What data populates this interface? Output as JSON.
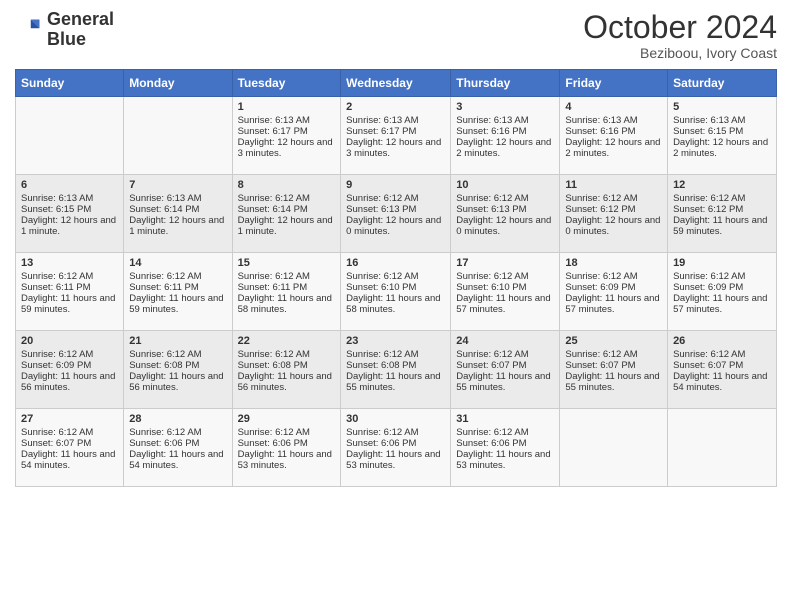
{
  "logo": {
    "line1": "General",
    "line2": "Blue"
  },
  "header": {
    "month": "October 2024",
    "location": "Beziboou, Ivory Coast"
  },
  "days": [
    "Sunday",
    "Monday",
    "Tuesday",
    "Wednesday",
    "Thursday",
    "Friday",
    "Saturday"
  ],
  "weeks": [
    [
      {
        "num": "",
        "sunrise": "",
        "sunset": "",
        "daylight": ""
      },
      {
        "num": "",
        "sunrise": "",
        "sunset": "",
        "daylight": ""
      },
      {
        "num": "1",
        "sunrise": "Sunrise: 6:13 AM",
        "sunset": "Sunset: 6:17 PM",
        "daylight": "Daylight: 12 hours and 3 minutes."
      },
      {
        "num": "2",
        "sunrise": "Sunrise: 6:13 AM",
        "sunset": "Sunset: 6:17 PM",
        "daylight": "Daylight: 12 hours and 3 minutes."
      },
      {
        "num": "3",
        "sunrise": "Sunrise: 6:13 AM",
        "sunset": "Sunset: 6:16 PM",
        "daylight": "Daylight: 12 hours and 2 minutes."
      },
      {
        "num": "4",
        "sunrise": "Sunrise: 6:13 AM",
        "sunset": "Sunset: 6:16 PM",
        "daylight": "Daylight: 12 hours and 2 minutes."
      },
      {
        "num": "5",
        "sunrise": "Sunrise: 6:13 AM",
        "sunset": "Sunset: 6:15 PM",
        "daylight": "Daylight: 12 hours and 2 minutes."
      }
    ],
    [
      {
        "num": "6",
        "sunrise": "Sunrise: 6:13 AM",
        "sunset": "Sunset: 6:15 PM",
        "daylight": "Daylight: 12 hours and 1 minute."
      },
      {
        "num": "7",
        "sunrise": "Sunrise: 6:13 AM",
        "sunset": "Sunset: 6:14 PM",
        "daylight": "Daylight: 12 hours and 1 minute."
      },
      {
        "num": "8",
        "sunrise": "Sunrise: 6:12 AM",
        "sunset": "Sunset: 6:14 PM",
        "daylight": "Daylight: 12 hours and 1 minute."
      },
      {
        "num": "9",
        "sunrise": "Sunrise: 6:12 AM",
        "sunset": "Sunset: 6:13 PM",
        "daylight": "Daylight: 12 hours and 0 minutes."
      },
      {
        "num": "10",
        "sunrise": "Sunrise: 6:12 AM",
        "sunset": "Sunset: 6:13 PM",
        "daylight": "Daylight: 12 hours and 0 minutes."
      },
      {
        "num": "11",
        "sunrise": "Sunrise: 6:12 AM",
        "sunset": "Sunset: 6:12 PM",
        "daylight": "Daylight: 12 hours and 0 minutes."
      },
      {
        "num": "12",
        "sunrise": "Sunrise: 6:12 AM",
        "sunset": "Sunset: 6:12 PM",
        "daylight": "Daylight: 11 hours and 59 minutes."
      }
    ],
    [
      {
        "num": "13",
        "sunrise": "Sunrise: 6:12 AM",
        "sunset": "Sunset: 6:11 PM",
        "daylight": "Daylight: 11 hours and 59 minutes."
      },
      {
        "num": "14",
        "sunrise": "Sunrise: 6:12 AM",
        "sunset": "Sunset: 6:11 PM",
        "daylight": "Daylight: 11 hours and 59 minutes."
      },
      {
        "num": "15",
        "sunrise": "Sunrise: 6:12 AM",
        "sunset": "Sunset: 6:11 PM",
        "daylight": "Daylight: 11 hours and 58 minutes."
      },
      {
        "num": "16",
        "sunrise": "Sunrise: 6:12 AM",
        "sunset": "Sunset: 6:10 PM",
        "daylight": "Daylight: 11 hours and 58 minutes."
      },
      {
        "num": "17",
        "sunrise": "Sunrise: 6:12 AM",
        "sunset": "Sunset: 6:10 PM",
        "daylight": "Daylight: 11 hours and 57 minutes."
      },
      {
        "num": "18",
        "sunrise": "Sunrise: 6:12 AM",
        "sunset": "Sunset: 6:09 PM",
        "daylight": "Daylight: 11 hours and 57 minutes."
      },
      {
        "num": "19",
        "sunrise": "Sunrise: 6:12 AM",
        "sunset": "Sunset: 6:09 PM",
        "daylight": "Daylight: 11 hours and 57 minutes."
      }
    ],
    [
      {
        "num": "20",
        "sunrise": "Sunrise: 6:12 AM",
        "sunset": "Sunset: 6:09 PM",
        "daylight": "Daylight: 11 hours and 56 minutes."
      },
      {
        "num": "21",
        "sunrise": "Sunrise: 6:12 AM",
        "sunset": "Sunset: 6:08 PM",
        "daylight": "Daylight: 11 hours and 56 minutes."
      },
      {
        "num": "22",
        "sunrise": "Sunrise: 6:12 AM",
        "sunset": "Sunset: 6:08 PM",
        "daylight": "Daylight: 11 hours and 56 minutes."
      },
      {
        "num": "23",
        "sunrise": "Sunrise: 6:12 AM",
        "sunset": "Sunset: 6:08 PM",
        "daylight": "Daylight: 11 hours and 55 minutes."
      },
      {
        "num": "24",
        "sunrise": "Sunrise: 6:12 AM",
        "sunset": "Sunset: 6:07 PM",
        "daylight": "Daylight: 11 hours and 55 minutes."
      },
      {
        "num": "25",
        "sunrise": "Sunrise: 6:12 AM",
        "sunset": "Sunset: 6:07 PM",
        "daylight": "Daylight: 11 hours and 55 minutes."
      },
      {
        "num": "26",
        "sunrise": "Sunrise: 6:12 AM",
        "sunset": "Sunset: 6:07 PM",
        "daylight": "Daylight: 11 hours and 54 minutes."
      }
    ],
    [
      {
        "num": "27",
        "sunrise": "Sunrise: 6:12 AM",
        "sunset": "Sunset: 6:07 PM",
        "daylight": "Daylight: 11 hours and 54 minutes."
      },
      {
        "num": "28",
        "sunrise": "Sunrise: 6:12 AM",
        "sunset": "Sunset: 6:06 PM",
        "daylight": "Daylight: 11 hours and 54 minutes."
      },
      {
        "num": "29",
        "sunrise": "Sunrise: 6:12 AM",
        "sunset": "Sunset: 6:06 PM",
        "daylight": "Daylight: 11 hours and 53 minutes."
      },
      {
        "num": "30",
        "sunrise": "Sunrise: 6:12 AM",
        "sunset": "Sunset: 6:06 PM",
        "daylight": "Daylight: 11 hours and 53 minutes."
      },
      {
        "num": "31",
        "sunrise": "Sunrise: 6:12 AM",
        "sunset": "Sunset: 6:06 PM",
        "daylight": "Daylight: 11 hours and 53 minutes."
      },
      {
        "num": "",
        "sunrise": "",
        "sunset": "",
        "daylight": ""
      },
      {
        "num": "",
        "sunrise": "",
        "sunset": "",
        "daylight": ""
      }
    ]
  ]
}
